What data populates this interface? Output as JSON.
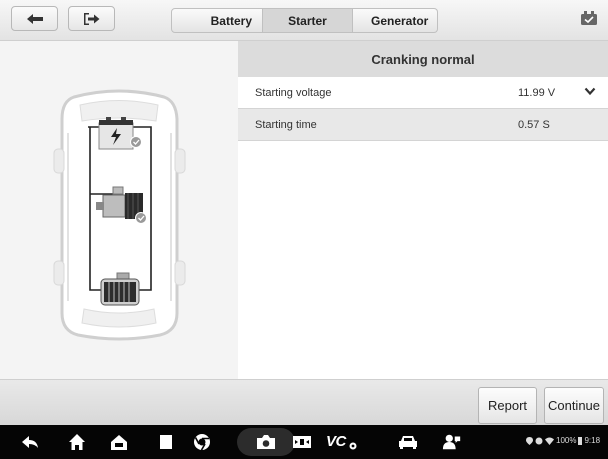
{
  "toolbar": {
    "tabs": [
      {
        "label": "Battery",
        "active": false
      },
      {
        "label": "Starter",
        "active": true
      },
      {
        "label": "Generator",
        "active": false
      }
    ]
  },
  "result": {
    "header": "Cranking normal",
    "rows": [
      {
        "name": "Starting voltage",
        "value": "11.99 V"
      },
      {
        "name": "Starting time",
        "value": "0.57 S"
      }
    ]
  },
  "actions": {
    "report": "Report",
    "continue": "Continue"
  },
  "system_bar": {
    "vc_label": "VC",
    "battery": "100%",
    "time": "9:18"
  },
  "colors": {
    "active_tab": "#d6d6d6",
    "check_badge": "#9a9a9a",
    "system_bar": "#050505"
  }
}
